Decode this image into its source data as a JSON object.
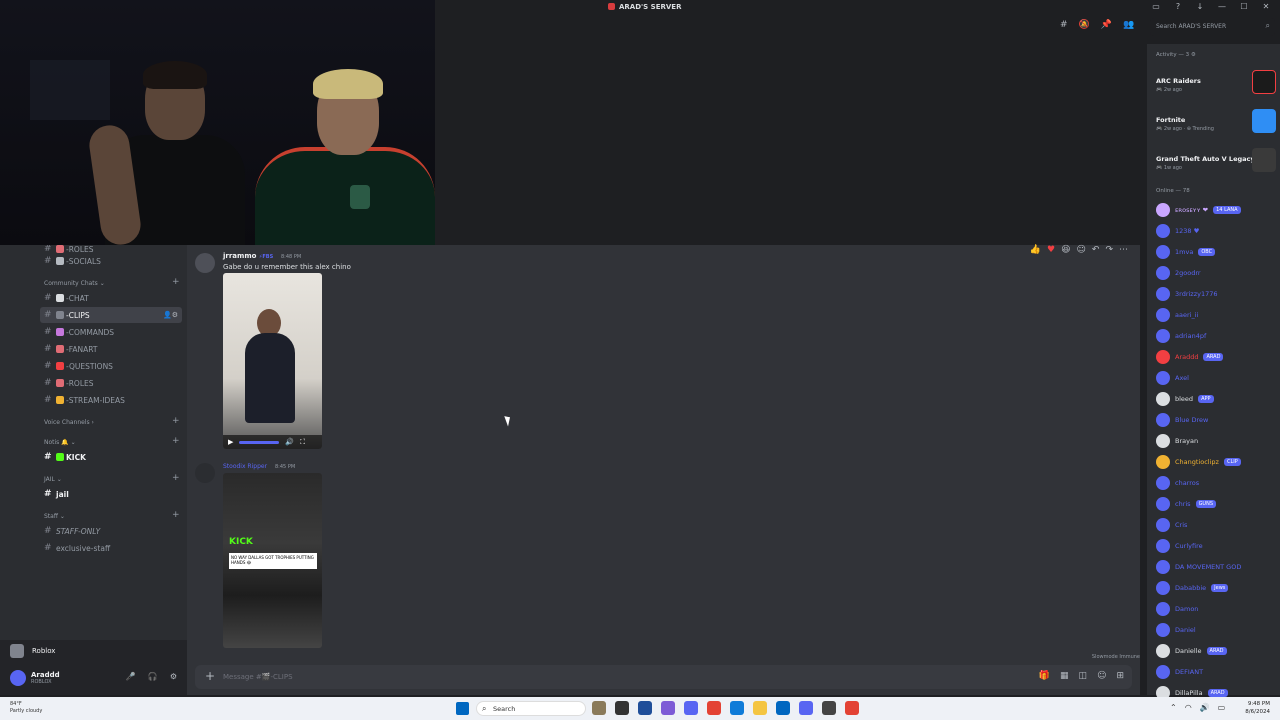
{
  "window": {
    "title": "ARAD'S SERVER",
    "buttons": [
      "—",
      "☐",
      "✕"
    ]
  },
  "sidebar": {
    "categories": {
      "community": "Community Chats ⌄",
      "voice": "Voice Channels ›",
      "notis": "Notis 🔔 ⌄",
      "jail": "JAIL ⌄",
      "staff": "Staff ⌄"
    },
    "channels": {
      "roles_top": "-ROLES",
      "socials": "-SOCIALS",
      "chat": "-CHAT",
      "clips": "-CLIPS",
      "commands": "-COMMANDS",
      "fanart": "-FANART",
      "questions": "-QUESTIONS",
      "roles": "-ROLES",
      "stream_ideas": "-STREAM-IDEAS",
      "kick": "KICK",
      "jail": "jail",
      "staff_only": "STAFF-ONLY",
      "exclusive_staff": "exclusive-staff"
    }
  },
  "voice": {
    "label": "Roblox"
  },
  "user": {
    "name": "Araddd",
    "status": "ROBLOX"
  },
  "messages": [
    {
      "author": "jrrammo",
      "badge": "⚡FBS",
      "time": "8:48 PM",
      "text": "Gabe do u remember this alex chino"
    },
    {
      "author": "Stoodix Ripper",
      "time": "8:45 PM",
      "text": ""
    }
  ],
  "video2": {
    "overlay_brand": "KICK",
    "caption": "NO WAY DALLAS GOT TROPHIES PUTTING HANDS 😂"
  },
  "composer": {
    "placeholder": "Message #🎬-CLIPS",
    "slowmode": "Slowmode Immune"
  },
  "search": {
    "placeholder": "Search ARAD'S SERVER"
  },
  "members": {
    "activity_header": "Activity — 3 ⚙",
    "activities": [
      {
        "game": "ARC Raiders",
        "sub": "🎮 2w ago",
        "color": "#1b1b1b"
      },
      {
        "game": "Fortnite",
        "sub": "🎮 2w ago · ⊕ Trending",
        "color": "#2f8ef4"
      },
      {
        "game": "Grand Theft Auto V Legacy",
        "sub": "🎮 1w ago",
        "color": "#3a3a3a"
      }
    ],
    "online_header": "Online — 78",
    "list": [
      {
        "name": "ᴇʀᴏsᴇʏʏ ❤",
        "tag": "14 LANA",
        "color": "#c9a6ff"
      },
      {
        "name": "1238 ♥",
        "tag": "",
        "color": "#5865f2"
      },
      {
        "name": "1mva",
        "tag": "OBC",
        "color": "#5865f2"
      },
      {
        "name": "2goodrr",
        "tag": "",
        "color": "#5865f2"
      },
      {
        "name": "3rdrizzy1776",
        "tag": "",
        "color": "#5865f2"
      },
      {
        "name": "aaeri_ii",
        "tag": "",
        "color": "#5865f2"
      },
      {
        "name": "adrian4pf",
        "tag": "",
        "color": "#5865f2"
      },
      {
        "name": "Araddd",
        "tag": "ARAD",
        "color": "#f23f42"
      },
      {
        "name": "Axel",
        "tag": "",
        "color": "#5865f2"
      },
      {
        "name": "bleed",
        "tag": "APP",
        "color": "#dbdee1"
      },
      {
        "name": "Blue Drew",
        "tag": "",
        "color": "#5865f2"
      },
      {
        "name": "Brayan",
        "tag": "",
        "color": "#dbdee1"
      },
      {
        "name": "Changtioclipz",
        "tag": "CLIP",
        "color": "#f0b232"
      },
      {
        "name": "charros",
        "tag": "",
        "color": "#5865f2"
      },
      {
        "name": "chris",
        "tag": "GUNS",
        "color": "#5865f2"
      },
      {
        "name": "Cris",
        "tag": "",
        "color": "#5865f2"
      },
      {
        "name": "Curlyfire",
        "tag": "",
        "color": "#5865f2"
      },
      {
        "name": "DA MOVEMENT GOD",
        "tag": "",
        "color": "#5865f2"
      },
      {
        "name": "Dababbie",
        "tag": "Jews",
        "color": "#5865f2"
      },
      {
        "name": "Damon",
        "tag": "",
        "color": "#5865f2"
      },
      {
        "name": "Daniel",
        "tag": "",
        "color": "#5865f2"
      },
      {
        "name": "Danielle",
        "tag": "ARAD",
        "color": "#dbdee1"
      },
      {
        "name": "DEFIANT",
        "tag": "",
        "color": "#5865f2"
      },
      {
        "name": "DillaPilla",
        "tag": "ARAD",
        "color": "#dbdee1"
      }
    ]
  },
  "taskbar": {
    "weather": "84°F",
    "weather_desc": "Partly cloudy",
    "search": "Search",
    "time": "9:48 PM",
    "date": "8/6/2024"
  }
}
